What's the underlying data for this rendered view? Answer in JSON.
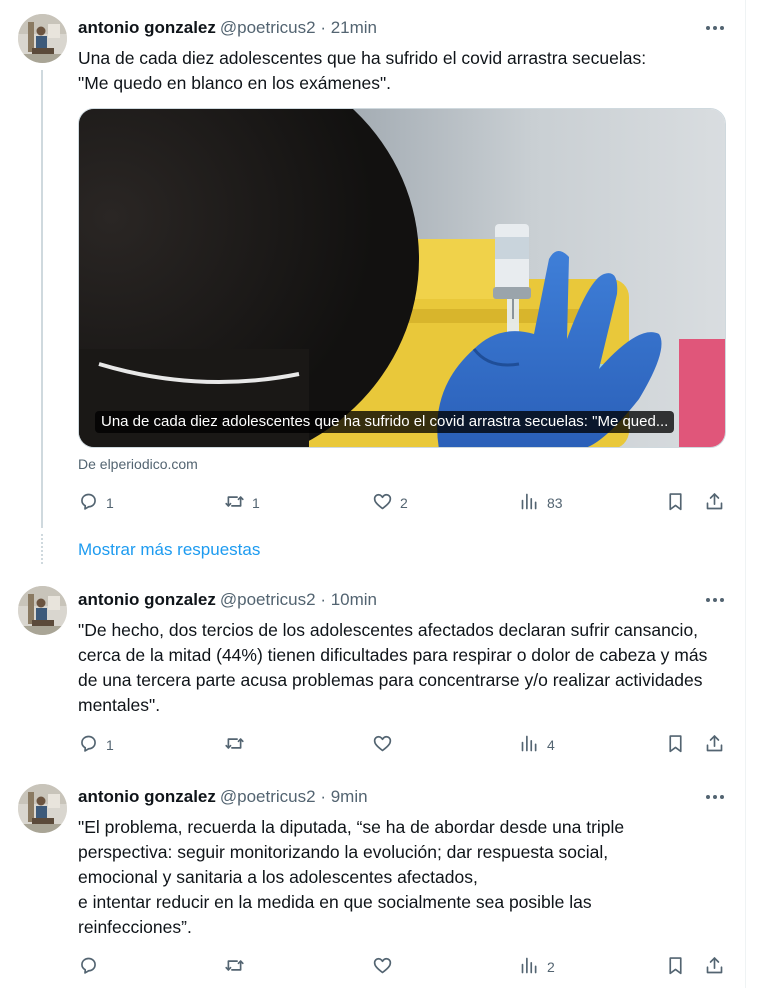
{
  "colors": {
    "text": "#0f1419",
    "secondary": "#536471",
    "link": "#1d9bf0",
    "line": "#cfd9de"
  },
  "tweets": [
    {
      "name": "antonio gonzalez",
      "handle": "@poetricus2",
      "time": "· 21min",
      "text": "Una de cada diez adolescentes que ha sufrido el covid arrastra secuelas:\n\"Me quedo en blanco en los exámenes\".",
      "card": {
        "caption": "Una de cada diez adolescentes que ha sufrido el covid arrastra secuelas: \"Me qued...",
        "source": "De elperiodico.com"
      },
      "stats": {
        "replies": "1",
        "retweets": "1",
        "likes": "2",
        "views": "83"
      }
    },
    {
      "name": "antonio gonzalez",
      "handle": "@poetricus2",
      "time": "· 10min",
      "text": "\"De hecho, dos tercios de los adolescentes afectados declaran sufrir cansancio, cerca de la mitad (44%) tienen dificultades para respirar o dolor de cabeza y más de una tercera parte acusa problemas para concentrarse y/o realizar actividades mentales\".",
      "stats": {
        "replies": "1",
        "retweets": "",
        "likes": "",
        "views": "4"
      }
    },
    {
      "name": "antonio gonzalez",
      "handle": "@poetricus2",
      "time": "· 9min",
      "text": "\"El problema, recuerda la diputada, “se ha de abordar desde una triple perspectiva: seguir monitorizando la evolución; dar respuesta social, emocional y sanitaria a los adolescentes afectados,\ne intentar reducir en la medida en que socialmente sea posible las reinfecciones”.",
      "stats": {
        "replies": "",
        "retweets": "",
        "likes": "",
        "views": "2"
      }
    }
  ],
  "show_more": "Mostrar más respuestas",
  "icons": {
    "more": "more-horizontal-icon",
    "reply": "reply-icon",
    "retweet": "retweet-icon",
    "like": "heart-icon",
    "views": "views-icon",
    "bookmark": "bookmark-icon",
    "share": "share-icon"
  }
}
